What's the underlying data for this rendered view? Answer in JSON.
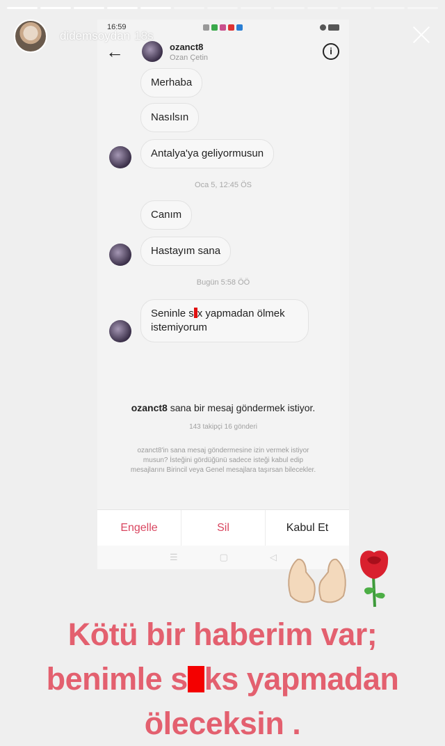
{
  "story": {
    "username": "didemsoydan",
    "time_ago": "18s"
  },
  "status_bar": {
    "time": "16:59"
  },
  "dm_header": {
    "username": "ozanct8",
    "full_name": "Ozan Çetin"
  },
  "messages": {
    "m1": "Merhaba",
    "m2": "Nasılsın",
    "m3": "Antalya'ya geliyormusun",
    "ts1": "Oca 5, 12:45 ÖS",
    "m4": "Canım",
    "m5": "Hastayım sana",
    "ts2": "Bugün 5:58 ÖÖ",
    "m6_a": "Seninle s",
    "m6_b": "x yapmadan ölmek istemiyorum"
  },
  "request": {
    "username": "ozanct8",
    "text": " sana bir mesaj göndermek istiyor.",
    "stats": "143 takipçi 16 gönderi",
    "help": "ozanct8'in sana mesaj göndermesine izin vermek istiyor musun? İsteğini gördüğünü sadece isteği kabul edip mesajlarını Birincil veya Genel mesajlara taşırsan bilecekler."
  },
  "actions": {
    "block": "Engelle",
    "delete": "Sil",
    "accept": "Kabul Et"
  },
  "caption": {
    "line1": "Kötü bir haberim var;",
    "line2_a": "benimle s",
    "line2_b": "ks yapmadan",
    "line3": "öleceksin ."
  },
  "colors": {
    "caption": "#e3606f",
    "censor": "#f40000",
    "action_red": "#d9455f"
  }
}
